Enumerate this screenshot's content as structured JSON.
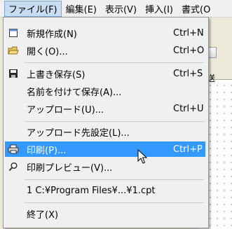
{
  "menubar": {
    "items": [
      {
        "label": "ファイル(F)",
        "active": true
      },
      {
        "label": "編集(E)"
      },
      {
        "label": "表示(V)"
      },
      {
        "label": "挿入(I)"
      },
      {
        "label": "書式(O"
      }
    ]
  },
  "background": {
    "send_label": "送"
  },
  "file_menu": {
    "new": {
      "label": "新規作成(N)",
      "shortcut": "Ctrl+N",
      "icon": "new-document-icon"
    },
    "open": {
      "label": "開く(O)...",
      "shortcut": "Ctrl+O",
      "icon": "folder-open-icon"
    },
    "save": {
      "label": "上書き保存(S)",
      "shortcut": "Ctrl+S",
      "icon": "floppy-disk-icon"
    },
    "save_as": {
      "label": "名前を付けて保存(A)..."
    },
    "upload": {
      "label": "アップロード(U)...",
      "shortcut": "Ctrl+U"
    },
    "upload_settings": {
      "label": "アップロード先設定(L)..."
    },
    "print": {
      "label": "印刷(P)...",
      "shortcut": "Ctrl+P",
      "icon": "printer-icon",
      "highlighted": true
    },
    "print_preview": {
      "label": "印刷プレビュー(V)...",
      "icon": "magnifier-icon"
    },
    "recent_1": {
      "label": "1 C:¥Program Files¥...¥1.cpt"
    },
    "exit": {
      "label": "終了(X)"
    }
  },
  "colors": {
    "highlight": "#3399ff",
    "menu_bg": "#f0f0f0",
    "menubar_active": "#c8ddf2"
  }
}
